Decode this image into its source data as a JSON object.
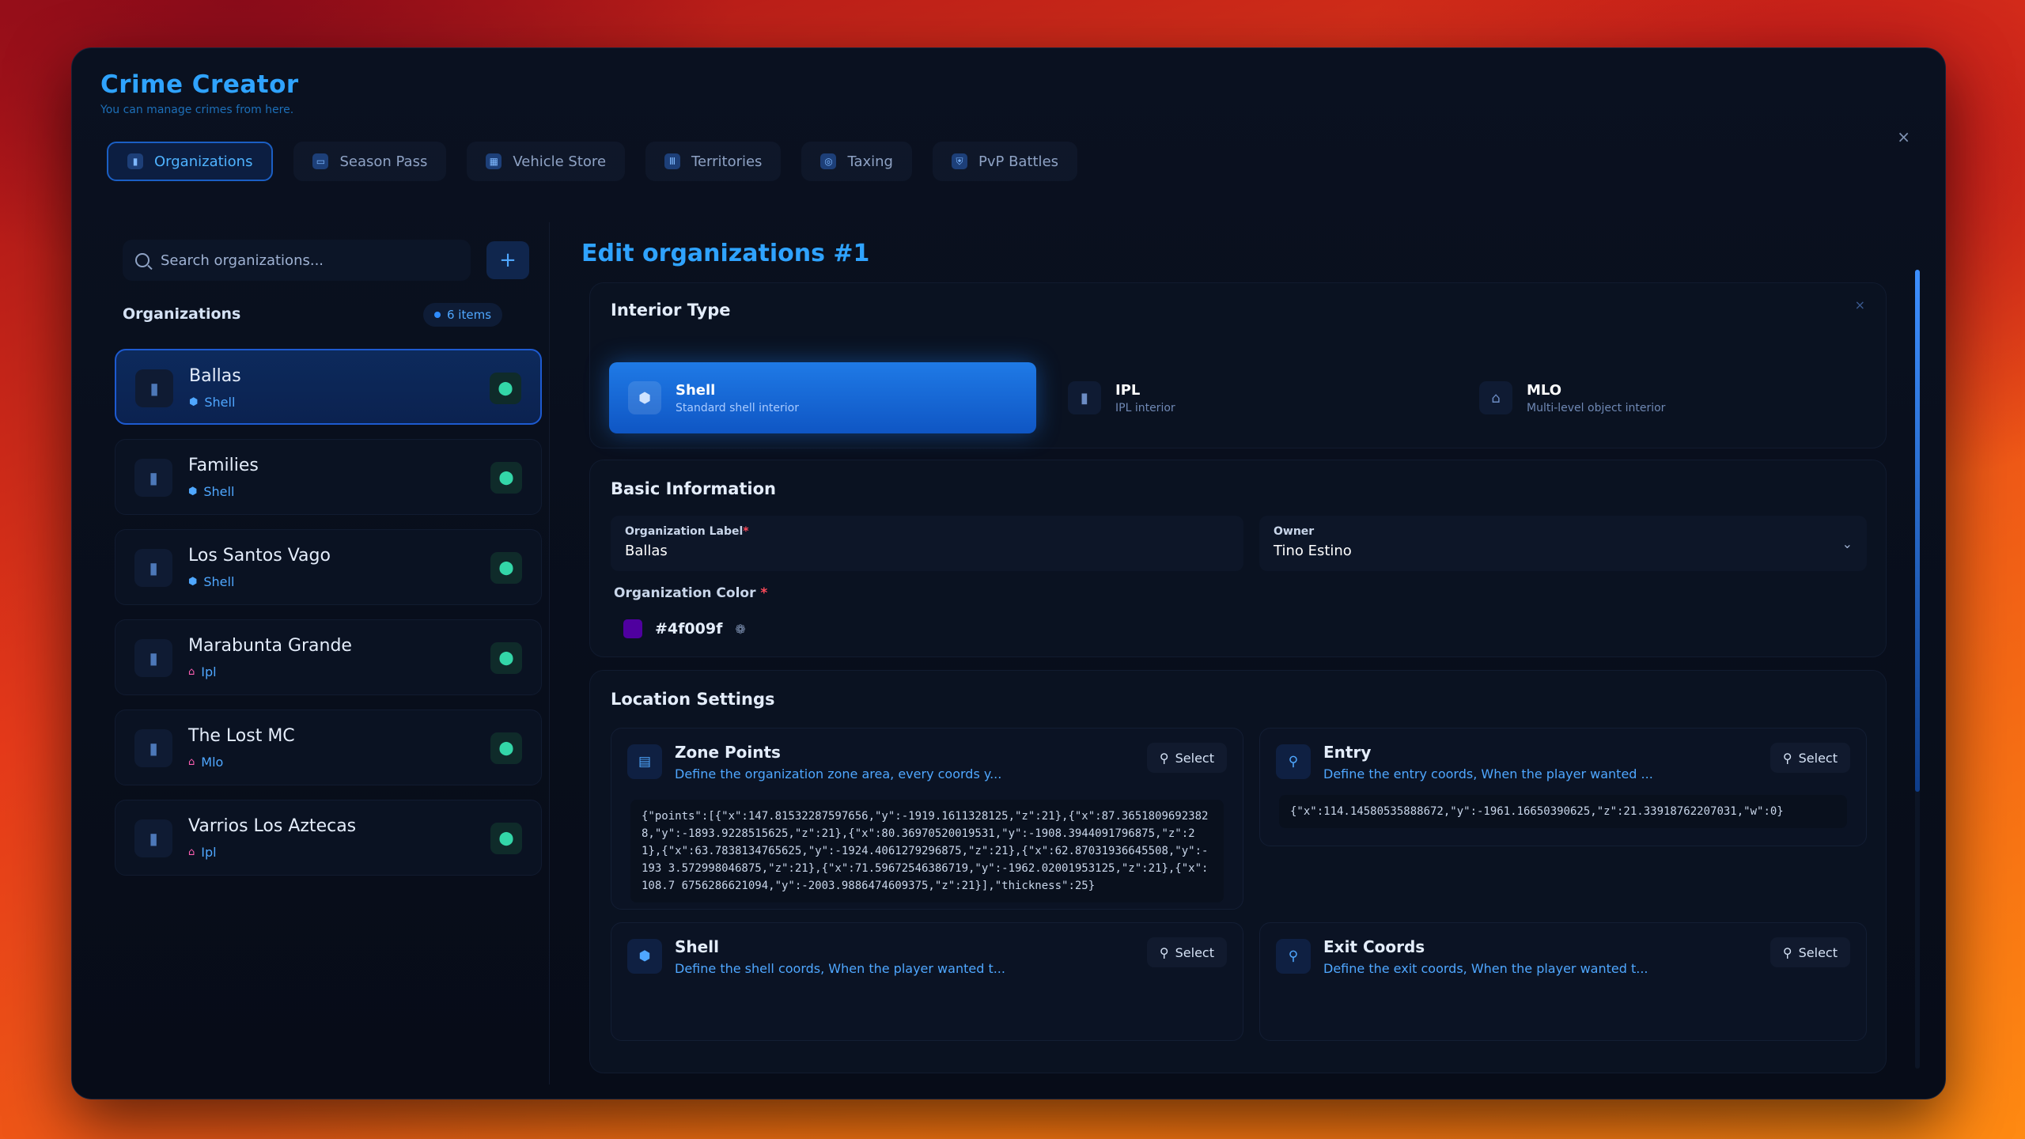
{
  "app": {
    "title": "Crime Creator",
    "subtitle": "You can manage crimes from here.",
    "close": "×"
  },
  "tabs": [
    {
      "label": "Organizations",
      "icon": "building-icon",
      "active": true
    },
    {
      "label": "Season Pass",
      "icon": "ticket-icon",
      "active": false
    },
    {
      "label": "Vehicle Store",
      "icon": "store-icon",
      "active": false
    },
    {
      "label": "Territories",
      "icon": "columns-icon",
      "active": false
    },
    {
      "label": "Taxing",
      "icon": "coins-icon",
      "active": false
    },
    {
      "label": "PvP Battles",
      "icon": "shield-icon",
      "active": false
    }
  ],
  "sidebar": {
    "search_placeholder": "Search organizations...",
    "add_label": "+",
    "heading": "Organizations",
    "count": "6 items",
    "items": [
      {
        "name": "Ballas",
        "type": "Shell",
        "active": true
      },
      {
        "name": "Families",
        "type": "Shell",
        "active": false
      },
      {
        "name": "Los Santos Vago",
        "type": "Shell",
        "active": false
      },
      {
        "name": "Marabunta Grande",
        "type": "Ipl",
        "active": false
      },
      {
        "name": "The Lost MC",
        "type": "Mlo",
        "active": false
      },
      {
        "name": "Varrios Los Aztecas",
        "type": "Ipl",
        "active": false
      }
    ]
  },
  "editor": {
    "title": "Edit organizations #1",
    "close": "×",
    "interior": {
      "section_title": "Interior Type",
      "options": [
        {
          "name": "Shell",
          "desc": "Standard shell interior",
          "active": true
        },
        {
          "name": "IPL",
          "desc": "IPL interior",
          "active": false
        },
        {
          "name": "MLO",
          "desc": "Multi-level object interior",
          "active": false
        }
      ]
    },
    "basic": {
      "section_title": "Basic Information",
      "label_field": {
        "label": "Organization Label",
        "required": "*",
        "value": "Ballas"
      },
      "owner_field": {
        "label": "Owner",
        "value": "Tino Estino"
      },
      "color_field": {
        "label": "Organization Color",
        "required": "*",
        "value": "#4f009f"
      }
    },
    "location": {
      "section_title": "Location Settings",
      "select_label": "Select",
      "zone": {
        "name": "Zone Points",
        "desc": "Define the organization zone area, every coords y...",
        "value": "{\"points\":[{\"x\":147.81532287597656,\"y\":-1919.1611328125,\"z\":21},{\"x\":87.3651809692382 8,\"y\":-1893.9228515625,\"z\":21},{\"x\":80.36970520019531,\"y\":-1908.3944091796875,\"z\":21},{\"x\":63.7838134765625,\"y\":-1924.4061279296875,\"z\":21},{\"x\":62.87031936645508,\"y\":-193 3.572998046875,\"z\":21},{\"x\":71.59672546386719,\"y\":-1962.02001953125,\"z\":21},{\"x\":108.7 6756286621094,\"y\":-2003.9886474609375,\"z\":21}],\"thickness\":25}"
      },
      "entry": {
        "name": "Entry",
        "desc": "Define the entry coords, When the player wanted ...",
        "value": "{\"x\":114.14580535888672,\"y\":-1961.16650390625,\"z\":21.33918762207031,\"w\":0}"
      },
      "shell": {
        "name": "Shell",
        "desc": "Define the shell coords, When the player wanted t..."
      },
      "exit": {
        "name": "Exit Coords",
        "desc": "Define the exit coords, When the player wanted t..."
      }
    }
  },
  "colors": {
    "accent": "#2fa3ff",
    "active_option": "#1f7ae6",
    "panel_bg": "#0a1120",
    "pin_green": "#33d6a8",
    "ipl_mlo_pink": "#ff5fb3"
  }
}
